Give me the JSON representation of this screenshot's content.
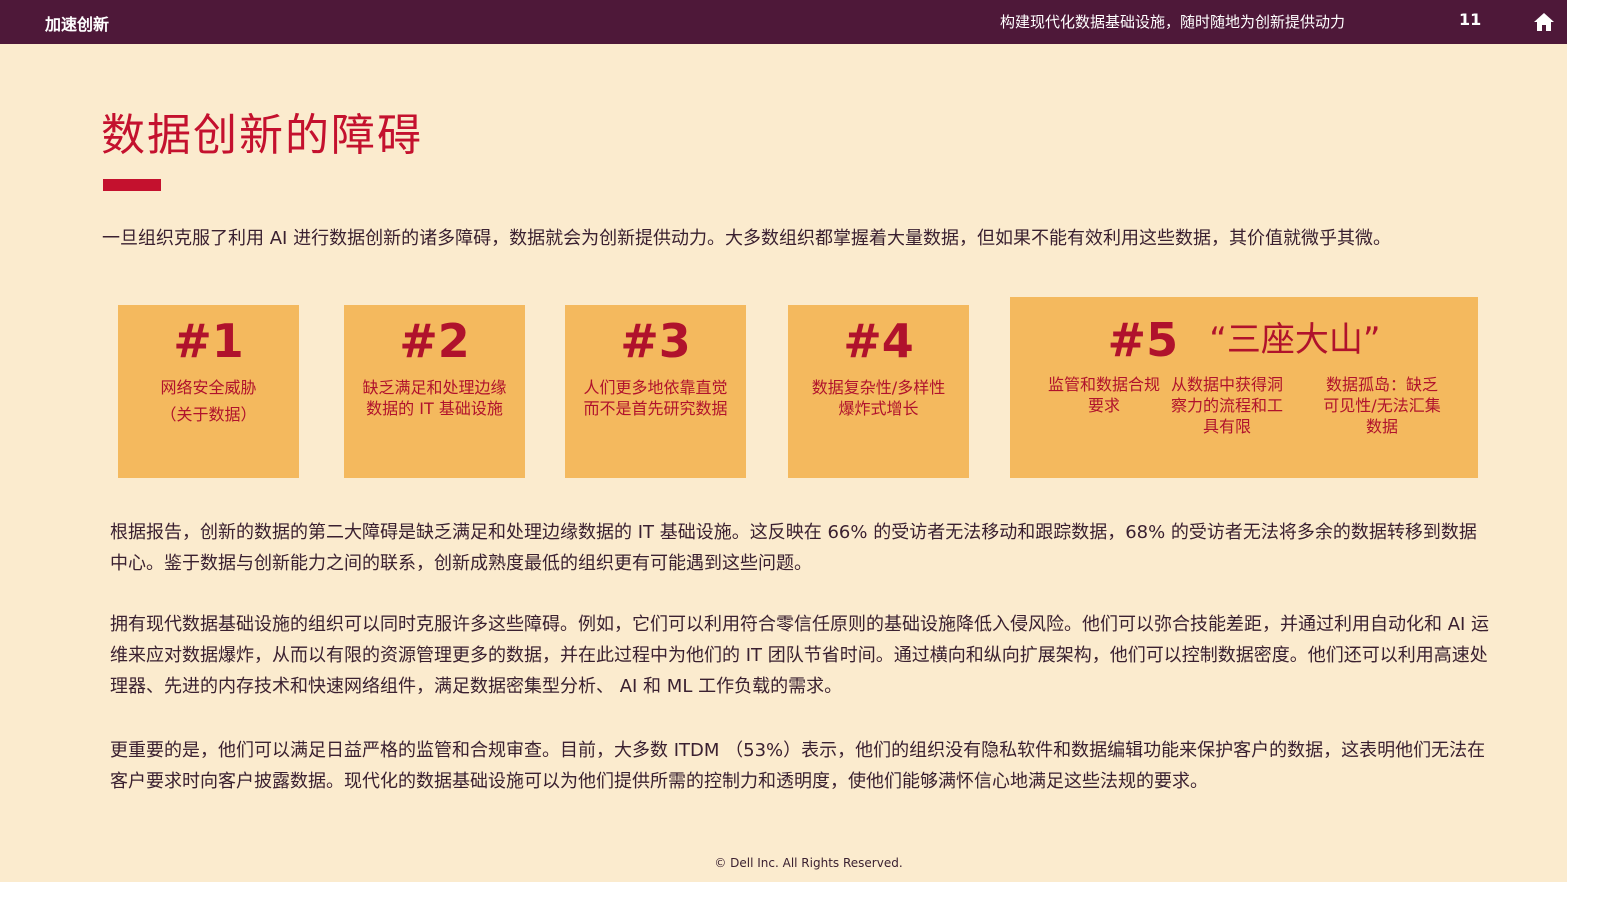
{
  "header": {
    "brand": "加速创新",
    "tagline": "构建现代化数据基础设施，随时随地为创新提供动力",
    "page_number": "11",
    "home_icon": "home-icon"
  },
  "title": "数据创新的障碍",
  "intro": "一旦组织克服了利用 AI 进行数据创新的诸多障碍，数据就会为创新提供动力。大多数组织都掌握着大量数据，但如果不能有效利用这些数据，其价值就微乎其微。",
  "cards": [
    {
      "num": "#1",
      "desc": "网络安全威胁",
      "sub": "（关于数据）"
    },
    {
      "num": "#2",
      "desc": "缺乏满足和处理边缘数据的 IT 基础设施"
    },
    {
      "num": "#3",
      "desc": "人们更多地依靠直觉而不是首先研究数据"
    },
    {
      "num": "#4",
      "desc": "数据复杂性/多样性爆炸式增长"
    }
  ],
  "card5": {
    "num": "#5",
    "subtitle": "“三座大山”",
    "items": [
      "监管和数据合规要求",
      "从数据中获得洞察力的流程和工具有限",
      "数据孤岛：缺乏可见性/无法汇集数据"
    ]
  },
  "paragraphs": [
    "根据报告，创新的数据的第二大障碍是缺乏满足和处理边缘数据的 IT 基础设施。这反映在 66% 的受访者无法移动和跟踪数据，68% 的受访者无法将多余的数据转移到数据中心。鉴于数据与创新能力之间的联系，创新成熟度最低的组织更有可能遇到这些问题。",
    "拥有现代数据基础设施的组织可以同时克服许多这些障碍。例如，它们可以利用符合零信任原则的基础设施降低入侵风险。他们可以弥合技能差距，并通过利用自动化和 AI 运维来应对数据爆炸，从而以有限的资源管理更多的数据，并在此过程中为他们的 IT 团队节省时间。通过横向和纵向扩展架构，他们可以控制数据密度。他们还可以利用高速处理器、先进的内存技术和快速网络组件，满足数据密集型分析、 AI 和 ML 工作负载的需求。",
    "更重要的是，他们可以满足日益严格的监管和合规审查。目前，大多数 ITDM （53%）表示，他们的组织没有隐私软件和数据编辑功能来保护客户的数据，这表明他们无法在客户要求时向客户披露数据。现代化的数据基础设施可以为他们提供所需的控制力和透明度，使他们能够满怀信心地满足这些法规的要求。"
  ],
  "footer": "© Dell Inc. All Rights Reserved.",
  "colors": {
    "header_bg": "#4e1839",
    "page_bg": "#fbebce",
    "accent": "#c4112e",
    "card_bg": "#f4b95e"
  }
}
